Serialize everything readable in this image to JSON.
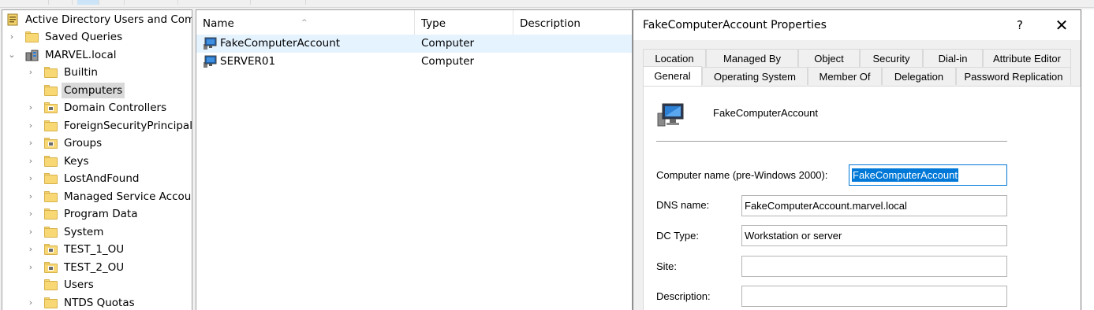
{
  "tree": {
    "root_label": "Active Directory Users and Comp",
    "items": [
      {
        "label": "Saved Queries",
        "type": "folder",
        "chev": "›",
        "indent": 0
      },
      {
        "label": "MARVEL.local",
        "type": "domain",
        "chev": "⌄",
        "indent": 0
      },
      {
        "label": "Builtin",
        "type": "folder",
        "chev": "›",
        "indent": 1
      },
      {
        "label": "Computers",
        "type": "folder",
        "chev": "",
        "indent": 1,
        "selected": true
      },
      {
        "label": "Domain Controllers",
        "type": "ou",
        "chev": "›",
        "indent": 1
      },
      {
        "label": "ForeignSecurityPrincipals",
        "type": "folder",
        "chev": "›",
        "indent": 1
      },
      {
        "label": "Groups",
        "type": "ou",
        "chev": "›",
        "indent": 1
      },
      {
        "label": "Keys",
        "type": "folder",
        "chev": "›",
        "indent": 1
      },
      {
        "label": "LostAndFound",
        "type": "folder",
        "chev": "›",
        "indent": 1
      },
      {
        "label": "Managed Service Accoun",
        "type": "folder",
        "chev": "›",
        "indent": 1
      },
      {
        "label": "Program Data",
        "type": "folder",
        "chev": "›",
        "indent": 1
      },
      {
        "label": "System",
        "type": "folder",
        "chev": "›",
        "indent": 1
      },
      {
        "label": "TEST_1_OU",
        "type": "ou",
        "chev": "›",
        "indent": 1
      },
      {
        "label": "TEST_2_OU",
        "type": "ou",
        "chev": "›",
        "indent": 1
      },
      {
        "label": "Users",
        "type": "folder",
        "chev": "",
        "indent": 1
      },
      {
        "label": "NTDS Quotas",
        "type": "folder",
        "chev": "›",
        "indent": 1
      }
    ]
  },
  "list": {
    "columns": [
      "Name",
      "Type",
      "Description"
    ],
    "sort_indicator": "^",
    "rows": [
      {
        "name": "FakeComputerAccount",
        "type": "Computer",
        "description": ""
      },
      {
        "name": "SERVER01",
        "type": "Computer",
        "description": ""
      }
    ]
  },
  "dialog": {
    "title": "FakeComputerAccount Properties",
    "help_label": "?",
    "close_label": "✕",
    "tabs_row1": [
      "Location",
      "Managed By",
      "Object",
      "Security",
      "Dial-in",
      "Attribute Editor"
    ],
    "tabs_row2": [
      "General",
      "Operating System",
      "Member Of",
      "Delegation",
      "Password Replication"
    ],
    "active_tab": "General",
    "account_name": "FakeComputerAccount",
    "fields": {
      "computer_name_label": "Computer name (pre-Windows 2000):",
      "computer_name_value": "FakeComputerAccount",
      "dns_label": "DNS name:",
      "dns_value": "FakeComputerAccount.marvel.local",
      "dc_type_label": "DC Type:",
      "dc_type_value": "Workstation or server",
      "site_label": "Site:",
      "site_value": "",
      "description_label": "Description:",
      "description_value": ""
    }
  },
  "colors": {
    "selection_blue": "#0078d7",
    "row_highlight": "#e5f3ff",
    "folder_yellow": "#f8d775"
  }
}
